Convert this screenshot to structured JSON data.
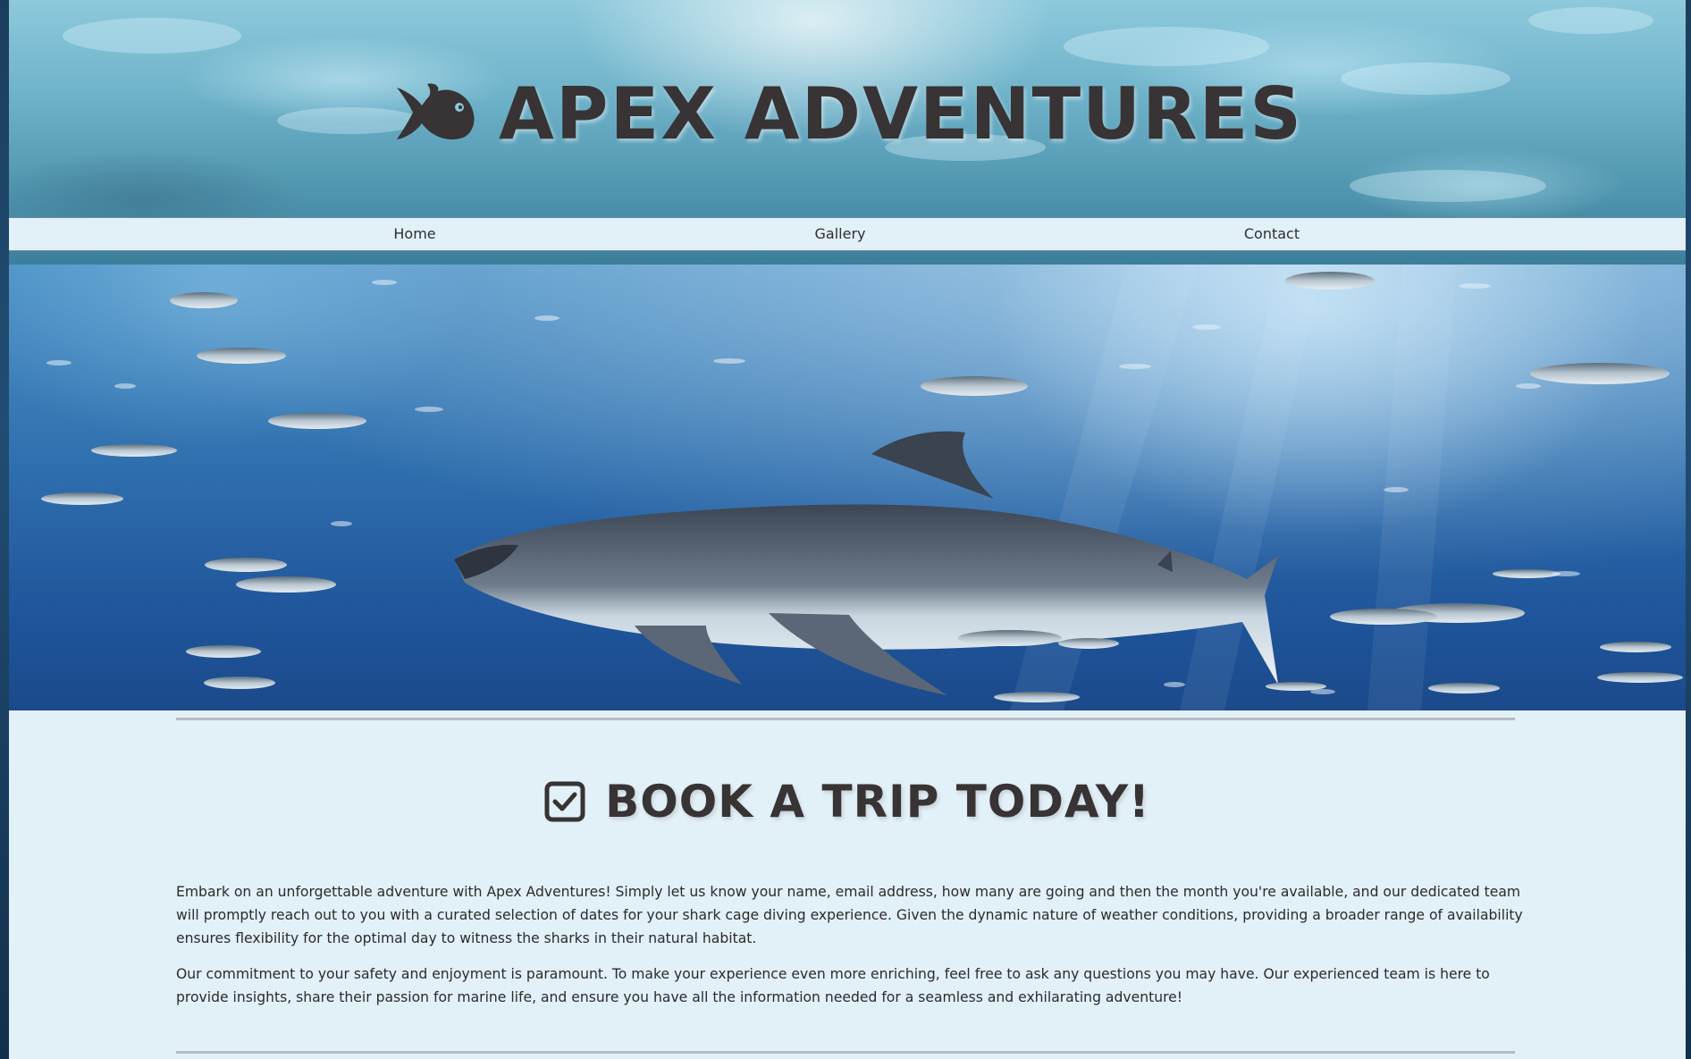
{
  "header": {
    "title": "Apex Adventures",
    "logo_icon": "fish-icon",
    "background": "underwater-surface"
  },
  "nav": {
    "items": [
      {
        "label": "Home"
      },
      {
        "label": "Gallery"
      },
      {
        "label": "Contact"
      }
    ]
  },
  "hero": {
    "image": "great white shark swimming among fish"
  },
  "booking": {
    "icon": "checkbox-icon",
    "heading": "Book a Trip Today!",
    "paragraphs": [
      "Embark on an unforgettable adventure with Apex Adventures! Simply let us know your name, email address, how many are going and then the month you're available, and our dedicated team will promptly reach out to you with a curated selection of dates for your shark cage diving experience. Given the dynamic nature of weather conditions, providing a broader range of availability ensures flexibility for the optimal day to witness the sharks in their natural habitat.",
      "Our commitment to your safety and enjoyment is paramount. To make your experience even more enriching, feel free to ask any questions you may have. Our experienced team is here to provide insights, share their passion for marine life, and ensure you have all the information needed for a seamless and exhilarating adventure!"
    ]
  },
  "colors": {
    "text_dark": "#383334",
    "nav_bg": "#e2f0f7",
    "content_bg": "#e2f0f7",
    "rule": "#b7bec3",
    "ocean_deep": "#1f549a"
  }
}
